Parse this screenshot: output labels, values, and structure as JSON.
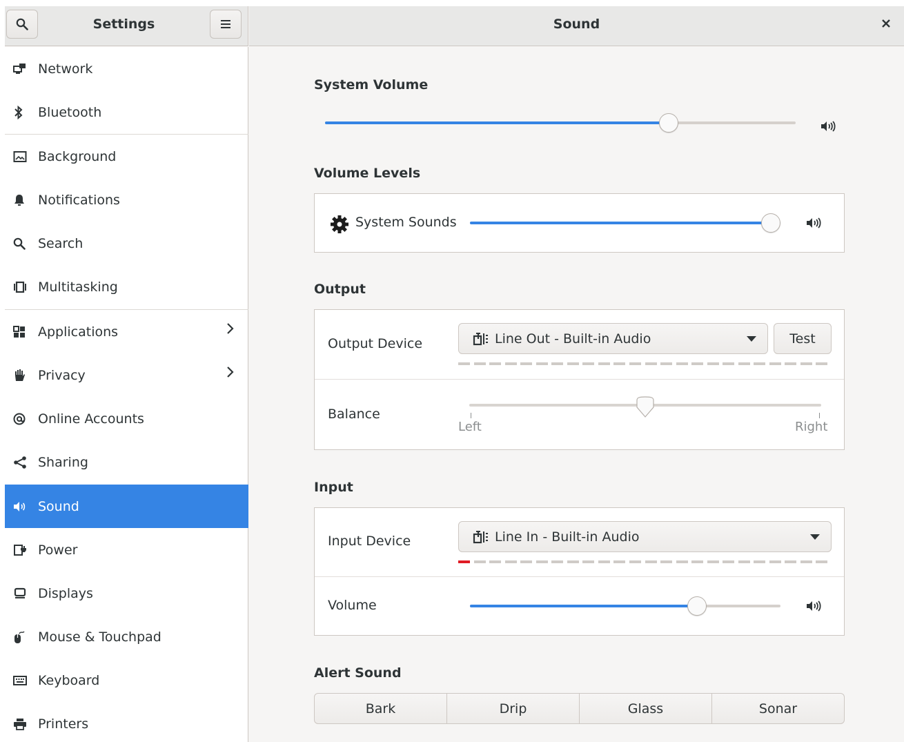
{
  "header": {
    "app_title": "Settings",
    "page_title": "Sound",
    "search_icon": "search-icon",
    "menu_icon": "hamburger-menu-icon",
    "close_icon": "close-icon"
  },
  "sidebar": {
    "items": [
      {
        "label": "Network",
        "icon": "network-icon"
      },
      {
        "label": "Bluetooth",
        "icon": "bluetooth-icon"
      },
      {
        "label": "Background",
        "icon": "background-icon"
      },
      {
        "label": "Notifications",
        "icon": "bell-icon"
      },
      {
        "label": "Search",
        "icon": "search-icon"
      },
      {
        "label": "Multitasking",
        "icon": "multitasking-icon"
      },
      {
        "label": "Applications",
        "icon": "applications-icon",
        "chevron": true
      },
      {
        "label": "Privacy",
        "icon": "hand-icon",
        "chevron": true
      },
      {
        "label": "Online Accounts",
        "icon": "at-sign-icon"
      },
      {
        "label": "Sharing",
        "icon": "share-icon"
      },
      {
        "label": "Sound",
        "icon": "speaker-icon",
        "active": true
      },
      {
        "label": "Power",
        "icon": "power-icon"
      },
      {
        "label": "Displays",
        "icon": "display-icon"
      },
      {
        "label": "Mouse & Touchpad",
        "icon": "mouse-icon"
      },
      {
        "label": "Keyboard",
        "icon": "keyboard-icon"
      },
      {
        "label": "Printers",
        "icon": "printer-icon"
      }
    ]
  },
  "system_volume": {
    "title": "System Volume",
    "level": 0.73
  },
  "volume_levels": {
    "title": "Volume Levels",
    "system_sounds_label": "System Sounds",
    "system_sounds_level": 1.0
  },
  "output": {
    "title": "Output",
    "device_label": "Output Device",
    "device_value": "Line Out - Built-in Audio",
    "test_label": "Test",
    "balance_label": "Balance",
    "balance_left": "Left",
    "balance_right": "Right",
    "balance_value": 0.5
  },
  "input": {
    "title": "Input",
    "device_label": "Input Device",
    "device_value": "Line In - Built-in Audio",
    "volume_label": "Volume",
    "volume_level": 0.73
  },
  "alert_sound": {
    "title": "Alert Sound",
    "options": [
      "Bark",
      "Drip",
      "Glass",
      "Sonar"
    ]
  },
  "colors": {
    "accent": "#3584e4",
    "input_level": "#e01b24"
  }
}
